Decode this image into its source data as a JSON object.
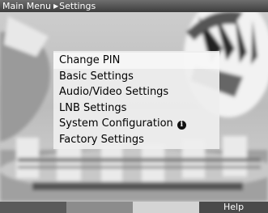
{
  "header": {
    "breadcrumb_root": "Main Menu",
    "breadcrumb_current": "Settings",
    "separator_icon": "triangle-right-icon"
  },
  "menu": {
    "items": [
      {
        "label": "Change PIN",
        "selected": true
      },
      {
        "label": "Basic Settings"
      },
      {
        "label": "Audio/Video Settings"
      },
      {
        "label": "LNB Settings"
      },
      {
        "label": "System Configuration",
        "icon": "info-icon",
        "icon_glyph": "i"
      },
      {
        "label": "Factory Settings"
      }
    ]
  },
  "footer": {
    "keys": [
      {
        "color": "red",
        "label": ""
      },
      {
        "color": "green",
        "label": ""
      },
      {
        "color": "yellow",
        "label": ""
      },
      {
        "color": "blue",
        "label": "Help"
      }
    ]
  },
  "colors": {
    "title_bar": "#4d4d4d",
    "menu_panel": "#eeeeee",
    "text": "#000000"
  }
}
